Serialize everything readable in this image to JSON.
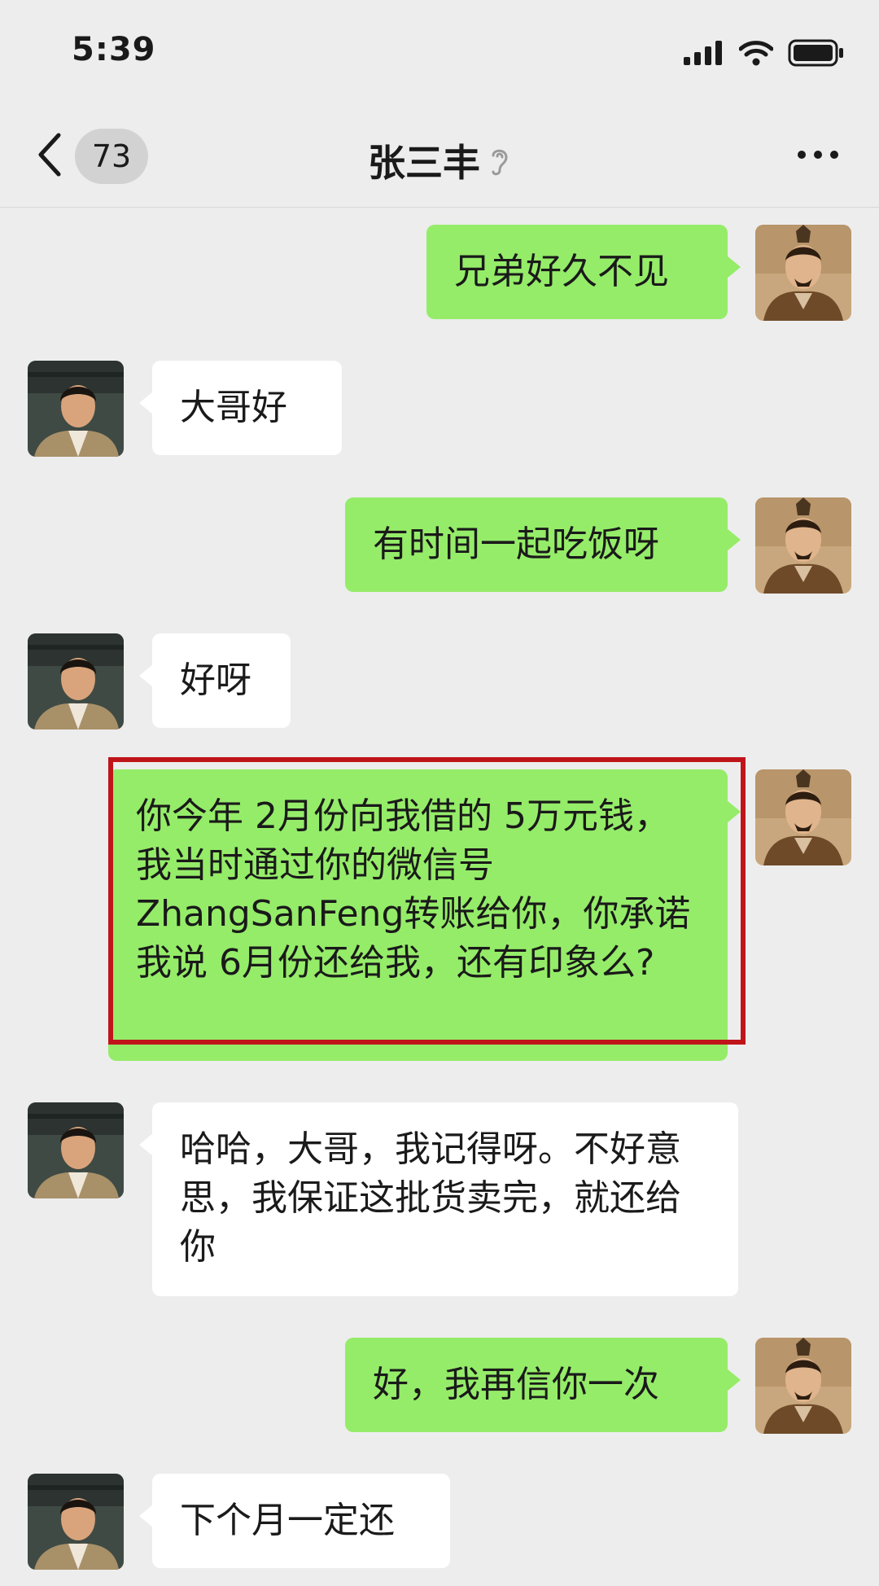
{
  "status_bar": {
    "time": "5:39"
  },
  "nav": {
    "unread_count": "73",
    "title": "张三丰"
  },
  "messages": [
    {
      "side": "me",
      "text": "兄弟好久不见"
    },
    {
      "side": "other",
      "text": "大哥好"
    },
    {
      "side": "me",
      "text": "有时间一起吃饭呀"
    },
    {
      "side": "other",
      "text": "好呀"
    },
    {
      "side": "me",
      "text": "你今年 2月份向我借的 5万元钱，我当时通过你的微信号 ZhangSanFeng转账给你，你承诺我说 6月份还给我，还有印象么?"
    },
    {
      "side": "other",
      "text": "哈哈，大哥，我记得呀。不好意思，我保证这批货卖完，就还给你"
    },
    {
      "side": "me",
      "text": "好，我再信你一次"
    },
    {
      "side": "other",
      "text": "下个月一定还"
    }
  ],
  "colors": {
    "my_bubble": "#95ec69",
    "their_bubble": "#ffffff",
    "highlight_box": "#c0141b",
    "background": "#ededed"
  }
}
